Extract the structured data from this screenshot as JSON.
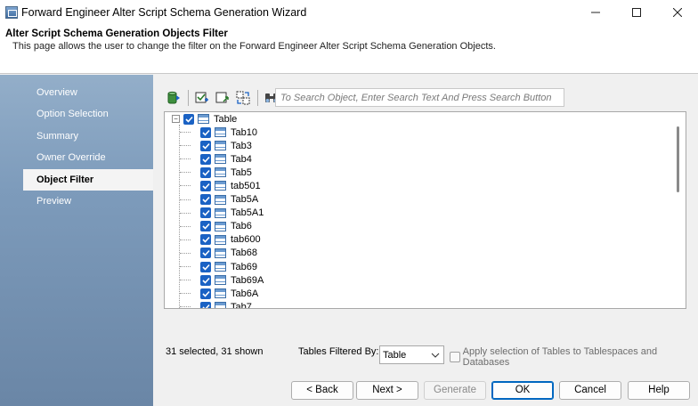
{
  "window": {
    "title": "Forward Engineer Alter Script Schema Generation Wizard",
    "controls": {
      "minimize": "—",
      "maximize": "☐",
      "close": "✕"
    }
  },
  "header": {
    "title": "Alter Script Schema Generation Objects Filter",
    "description": "This page allows the user to change the filter on the Forward Engineer Alter Script Schema Generation Objects."
  },
  "sidebar": {
    "items": [
      {
        "label": "Overview",
        "active": false
      },
      {
        "label": "Option Selection",
        "active": false
      },
      {
        "label": "Summary",
        "active": false
      },
      {
        "label": "Owner Override",
        "active": false
      },
      {
        "label": "Object Filter",
        "active": true
      },
      {
        "label": "Preview",
        "active": false
      }
    ]
  },
  "search": {
    "placeholder": "To Search Object, Enter Search Text And Press Search Button"
  },
  "tree": {
    "root": {
      "label": "Table",
      "checked": true,
      "expanded": true
    },
    "children": [
      "Tab10",
      "Tab3",
      "Tab4",
      "Tab5",
      "tab501",
      "Tab5A",
      "Tab5A1",
      "Tab6",
      "tab600",
      "Tab68",
      "Tab69",
      "Tab69A",
      "Tab6A",
      "Tab7"
    ]
  },
  "footer": {
    "status": "31 selected, 31 shown",
    "filter_label": "Tables Filtered By:",
    "filter_value": "Table",
    "apply_label": "Apply selection of Tables to Tablespaces and Databases",
    "apply_checked": false
  },
  "buttons": {
    "back": "< Back",
    "next": "Next >",
    "generate": "Generate",
    "ok": "OK",
    "cancel": "Cancel",
    "help": "Help"
  },
  "colors": {
    "accent": "#1a62c4",
    "sidebar_top": "#93aec9",
    "sidebar_bottom": "#6a86a6"
  }
}
